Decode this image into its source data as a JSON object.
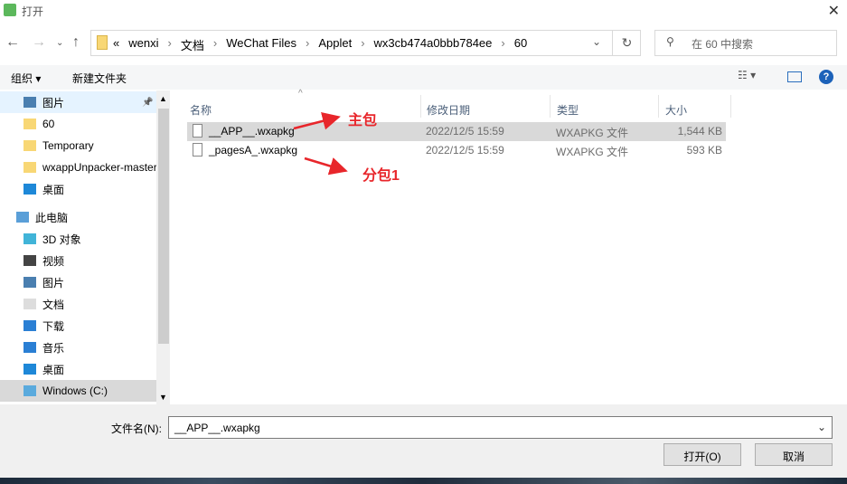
{
  "window": {
    "title": "打开",
    "close": "✕"
  },
  "address": {
    "overflow": "«",
    "crumbs": [
      "wenxi",
      "文档",
      "WeChat Files",
      "Applet",
      "wx3cb474a0bbb784ee",
      "60"
    ],
    "search_placeholder": "在 60 中搜索"
  },
  "toolbar": {
    "organize": "组织",
    "new_folder": "新建文件夹"
  },
  "sidebar": {
    "items": [
      {
        "label": "图片",
        "icon": "pictures-icon"
      },
      {
        "label": "60",
        "icon": "folder-icon"
      },
      {
        "label": "Temporary",
        "icon": "folder-icon"
      },
      {
        "label": "wxappUnpacker-master",
        "icon": "folder-icon"
      },
      {
        "label": "桌面",
        "icon": "desktop-icon"
      },
      {
        "label": "此电脑",
        "icon": "computer-icon"
      },
      {
        "label": "3D 对象",
        "icon": "3d-objects-icon"
      },
      {
        "label": "视频",
        "icon": "videos-icon"
      },
      {
        "label": "图片",
        "icon": "pictures-icon"
      },
      {
        "label": "文档",
        "icon": "documents-icon"
      },
      {
        "label": "下载",
        "icon": "downloads-icon"
      },
      {
        "label": "音乐",
        "icon": "music-icon"
      },
      {
        "label": "桌面",
        "icon": "desktop-icon"
      },
      {
        "label": "Windows (C:)",
        "icon": "drive-icon"
      }
    ]
  },
  "columns": [
    "名称",
    "修改日期",
    "类型",
    "大小"
  ],
  "files": [
    {
      "name": "__APP__.wxapkg",
      "date": "2022/12/5 15:59",
      "type": "WXAPKG 文件",
      "size": "1,544 KB",
      "selected": true
    },
    {
      "name": "_pagesA_.wxapkg",
      "date": "2022/12/5 15:59",
      "type": "WXAPKG 文件",
      "size": "593 KB",
      "selected": false
    }
  ],
  "annotations": {
    "main": "主包",
    "sub": "分包1",
    "color": "#e8262b"
  },
  "footer": {
    "filename_label": "文件名(N):",
    "filename_value": "__APP__.wxapkg",
    "open": "打开(O)",
    "cancel": "取消"
  }
}
